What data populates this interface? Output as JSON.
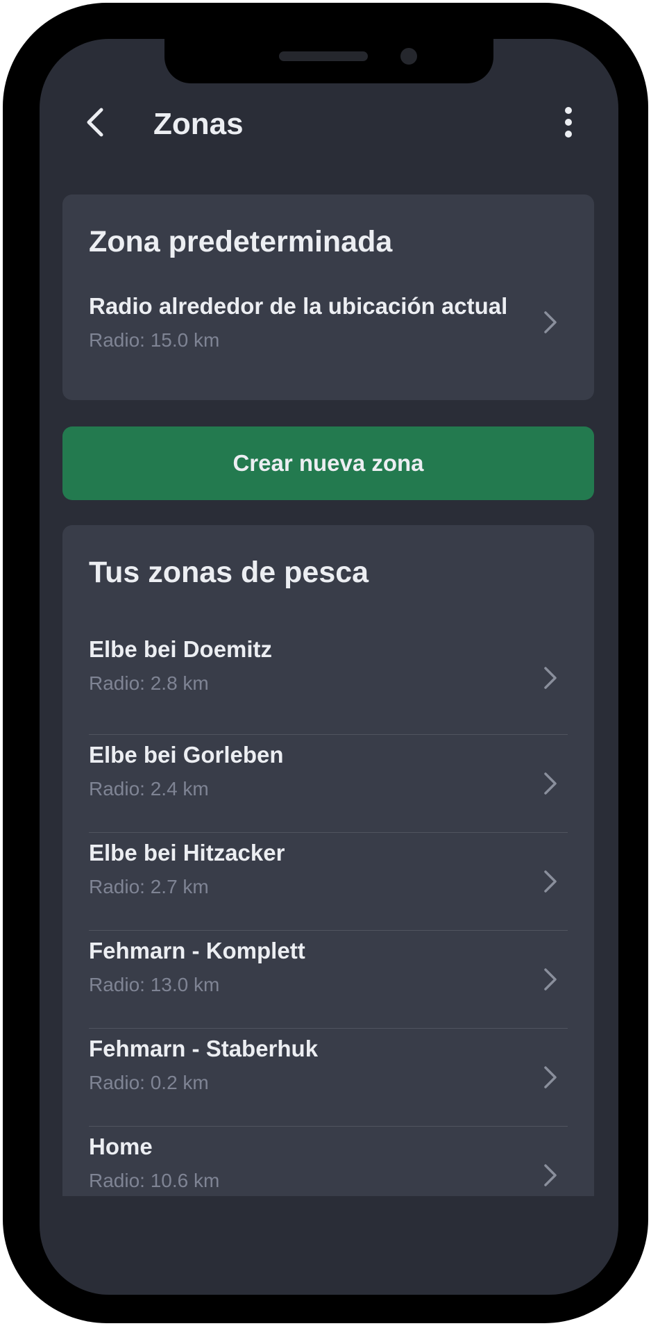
{
  "header": {
    "title": "Zonas",
    "back_icon": "chevron-left-icon",
    "menu_icon": "more-vertical-icon"
  },
  "default_zone": {
    "title": "Zona predeterminada",
    "item": {
      "name": "Radio alrededor de la ubicación actual",
      "radius": "Radio: 15.0 km"
    }
  },
  "create_button": {
    "label": "Crear nueva zona"
  },
  "zones": {
    "title": "Tus zonas de pesca",
    "items": [
      {
        "name": "Elbe bei Doemitz",
        "radius": "Radio: 2.8 km"
      },
      {
        "name": "Elbe bei Gorleben",
        "radius": "Radio: 2.4 km"
      },
      {
        "name": "Elbe bei Hitzacker",
        "radius": "Radio: 2.7 km"
      },
      {
        "name": "Fehmarn - Komplett",
        "radius": "Radio: 13.0 km"
      },
      {
        "name": "Fehmarn - Staberhuk",
        "radius": "Radio: 0.2 km"
      },
      {
        "name": "Home",
        "radius": "Radio: 10.6 km"
      }
    ]
  },
  "colors": {
    "background": "#2a2d37",
    "card": "#393d49",
    "accent_green": "#237a4f",
    "text_primary": "#eceef2",
    "text_secondary": "#7f8494"
  }
}
